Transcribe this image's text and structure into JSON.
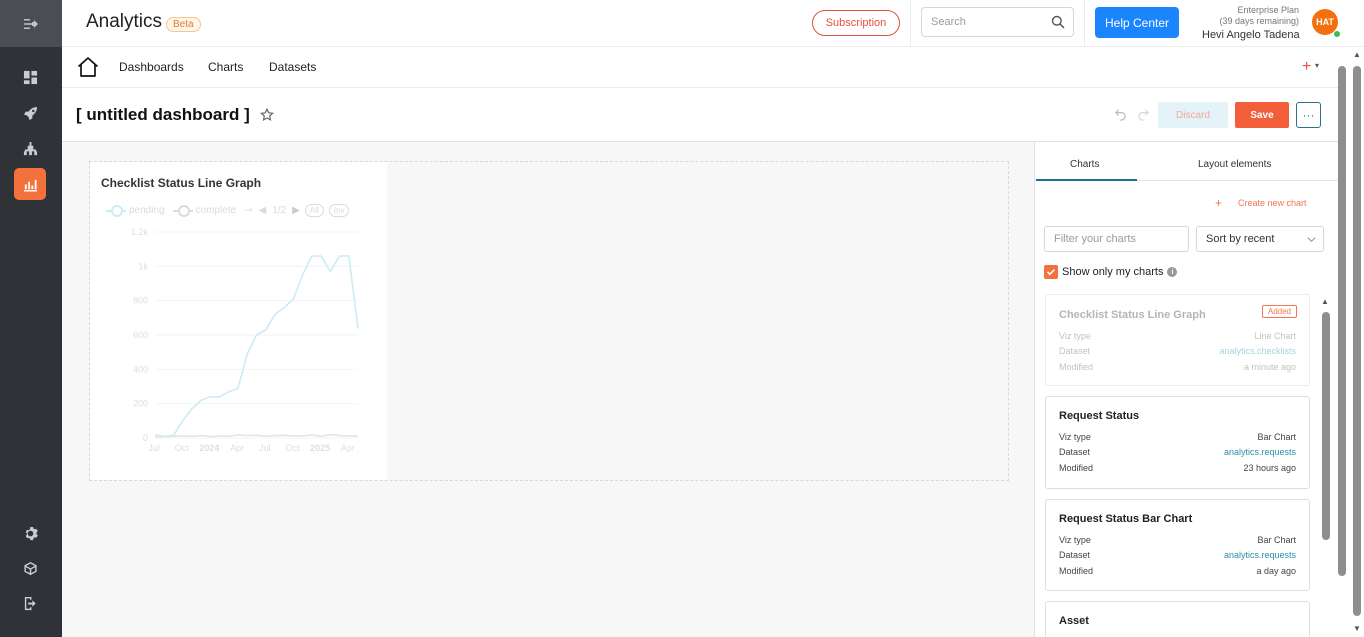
{
  "app": {
    "title": "Analytics",
    "badge": "Beta"
  },
  "header": {
    "subscription_label": "Subscription",
    "search_placeholder": "Search",
    "help_label": "Help Center",
    "plan_name": "Enterprise Plan",
    "plan_remaining": "(39 days remaining)",
    "user_name": "Hevi Angelo Tadena",
    "avatar_initials": "HAT"
  },
  "nav": {
    "items": [
      "Dashboards",
      "Charts",
      "Datasets"
    ]
  },
  "dashboard": {
    "title": "[ untitled dashboard ]",
    "discard_label": "Discard",
    "save_label": "Save",
    "more_label": "···"
  },
  "chart_card": {
    "title": "Checklist Status Line Graph",
    "legend": {
      "pending": "pending",
      "complete": "complete",
      "page": "1/2",
      "all": "All",
      "inv": "Inv"
    }
  },
  "chart_data": {
    "type": "line",
    "x_ticks": [
      "Jul",
      "Oct",
      "2024",
      "Apr",
      "Jul",
      "Oct",
      "2025",
      "Apr"
    ],
    "y_ticks": [
      "0",
      "200",
      "400",
      "600",
      "800",
      "1k",
      "1.2k"
    ],
    "ylim": [
      0,
      1200
    ],
    "series": [
      {
        "name": "pending",
        "values": [
          20,
          10,
          15,
          100,
          170,
          220,
          240,
          240,
          270,
          290,
          490,
          600,
          630,
          720,
          760,
          810,
          950,
          1060,
          1060,
          970,
          1060,
          1060,
          640
        ]
      },
      {
        "name": "complete",
        "values": [
          5,
          8,
          10,
          12,
          10,
          14,
          8,
          12,
          10,
          18,
          14,
          16,
          10,
          14,
          16,
          12,
          12,
          18,
          10,
          20,
          14,
          12,
          10
        ]
      }
    ],
    "colors": {
      "pending": "#cdebf4",
      "complete": "#dfe5e8"
    }
  },
  "right_panel": {
    "tabs": [
      "Charts",
      "Layout elements"
    ],
    "create_label": "Create new chart",
    "filter_placeholder": "Filter your charts",
    "sort_label": "Sort by recent",
    "only_mine_label": "Show only my charts",
    "keys": {
      "viz": "Viz type",
      "dataset": "Dataset",
      "modified": "Modified"
    },
    "charts": [
      {
        "title": "Checklist Status Line Graph",
        "viz": "Line Chart",
        "dataset": "analytics.checklists",
        "modified": "a minute ago",
        "badge": "Added"
      },
      {
        "title": "Request Status",
        "viz": "Bar Chart",
        "dataset": "analytics.requests",
        "modified": "23 hours ago"
      },
      {
        "title": "Request Status Bar Chart",
        "viz": "Bar Chart",
        "dataset": "analytics.requests",
        "modified": "a day ago"
      },
      {
        "title": "Asset"
      }
    ]
  },
  "colors": {
    "accent": "#f4703d",
    "primary": "#1a85ff",
    "sidebar": "#2f3337"
  }
}
